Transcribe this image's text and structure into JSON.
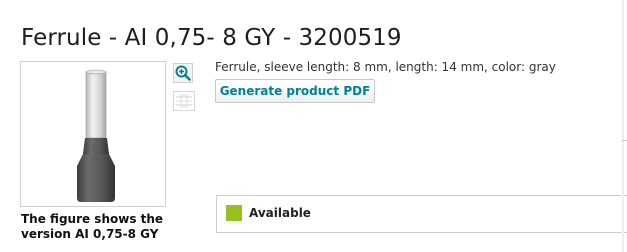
{
  "product": {
    "title": "Ferrule - AI 0,75- 8 GY - 3200519",
    "description": "Ferrule, sleeve length: 8 mm, length: 14 mm, color: gray"
  },
  "gallery": {
    "zoom_icon": "zoom-in-icon",
    "thumbnail_icon": "drawing-thumbnail-icon",
    "caption_line1": "The figure shows the",
    "caption_line2": "version AI 0,75-8 GY"
  },
  "actions": {
    "generate_pdf_label": "Generate product PDF"
  },
  "availability": {
    "status_label": "Available",
    "status_color": "#96c11f"
  },
  "colors": {
    "accent": "#008398",
    "ferrule_body": "#5a5a5a",
    "ferrule_sleeve": "#d9d9d9"
  }
}
